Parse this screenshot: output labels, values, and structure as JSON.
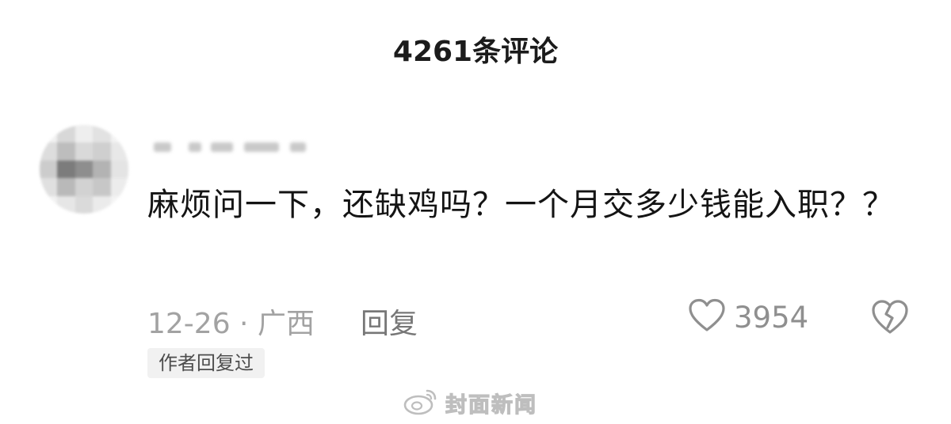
{
  "header": {
    "title": "4261条评论"
  },
  "comment": {
    "text": "麻烦问一下，还缺鸡吗？一个月交多少钱能入职？？",
    "date_location": "12-26 · 广西",
    "reply_label": "回复",
    "like_count": "3954",
    "author_badge": "作者回复过"
  },
  "watermark": {
    "text": "封面新闻"
  },
  "icons": {
    "like": "heart-outline-icon",
    "dislike": "broken-heart-icon",
    "watermark": "weibo-icon"
  }
}
